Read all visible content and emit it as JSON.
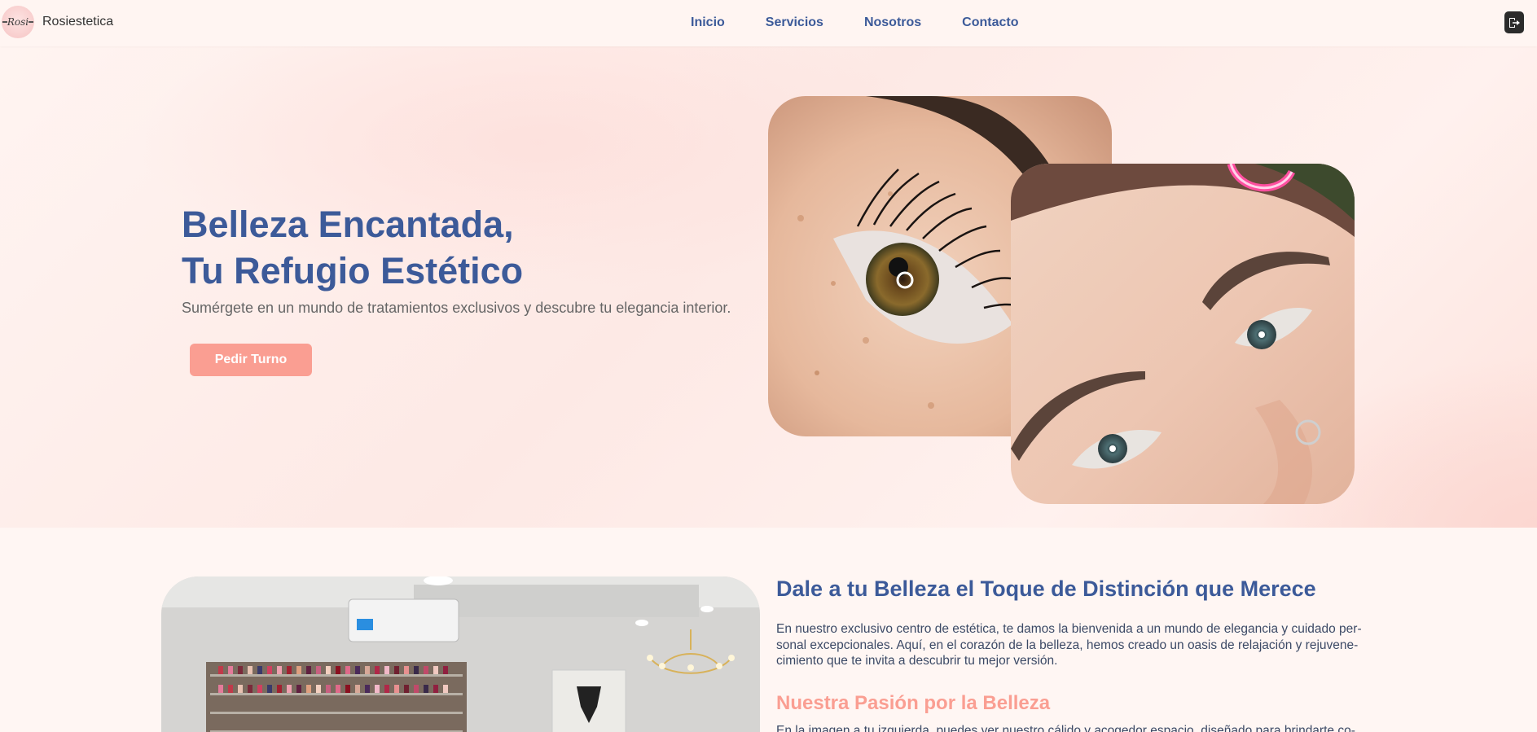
{
  "brand": {
    "logo_text": "Rosi",
    "name": "Rosiestetica"
  },
  "nav": {
    "items": [
      {
        "label": "Inicio"
      },
      {
        "label": "Servicios"
      },
      {
        "label": "Nosotros"
      },
      {
        "label": "Contacto"
      }
    ],
    "logout_icon": "logout-icon"
  },
  "hero": {
    "title_line1": "Belleza Encantada,",
    "title_line2": "Tu Refugio Estético",
    "subtitle": "Sumérgete en un mundo de tratamientos exclusivos y descubre tu elegancia interior.",
    "cta_label": "Pedir Turno"
  },
  "about": {
    "heading": "Dale a tu Belleza el Toque de Distinción que Merece",
    "text": "En nuestro exclusivo centro de estética, te damos la bienvenida a un mundo de elegancia y cuidado per-sonal excepcionales. Aquí, en el corazón de la belleza, hemos creado un oasis de relajación y rejuvene-cimiento que te invita a descubrir tu mejor versión.",
    "passion_heading": "Nuestra Pasión por la Belleza",
    "passion_text": "En la imagen a tu izquierda, puedes ver nuestro cálido y acogedor espacio, diseñado para brindarte co-"
  },
  "colors": {
    "primary": "#3c5a99",
    "accent": "#fa9e92",
    "background": "#fff6f3"
  }
}
